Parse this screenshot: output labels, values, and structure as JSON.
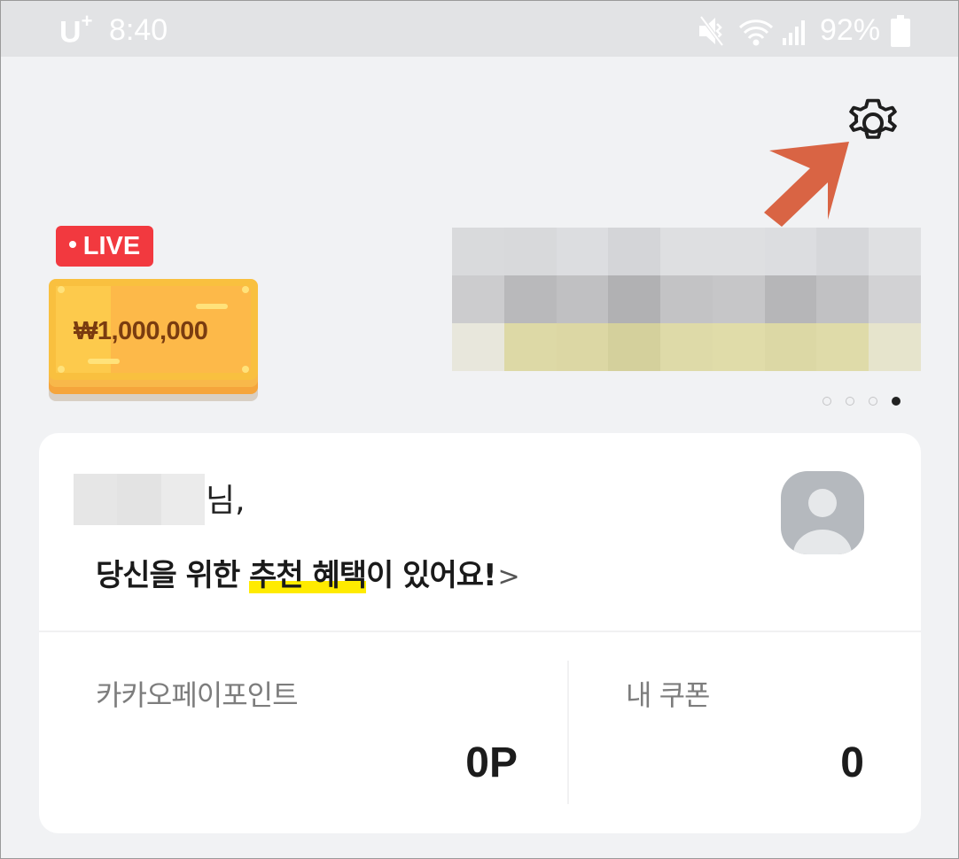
{
  "status_bar": {
    "carrier": "U",
    "carrier_sup": "+",
    "time": "8:40",
    "battery_percent": "92%",
    "icons": [
      "mute-vibrate-icon",
      "wifi-icon",
      "signal-icon",
      "battery-icon"
    ]
  },
  "header": {
    "settings_icon": "gear-icon",
    "annotation_icon": "arrow-icon",
    "annotation_color": "#d96444"
  },
  "banner": {
    "live_label": "LIVE",
    "ticket_amount": "₩1,000,000",
    "carousel": {
      "total": 4,
      "active_index": 3
    }
  },
  "card": {
    "greeting_suffix": "님,",
    "promo_before": "당신을 위한 ",
    "promo_highlight": "추천 혜택",
    "promo_after": "이 있어요!",
    "promo_chevron": ">",
    "avatar_icon": "person-avatar-icon",
    "points_label": "카카오페이포인트",
    "points_value": "0P",
    "coupons_label": "내 쿠폰",
    "coupons_value": "0"
  },
  "colors": {
    "background": "#f1f2f4",
    "live_red": "#f2393f",
    "highlight_yellow": "#ffeb00"
  }
}
